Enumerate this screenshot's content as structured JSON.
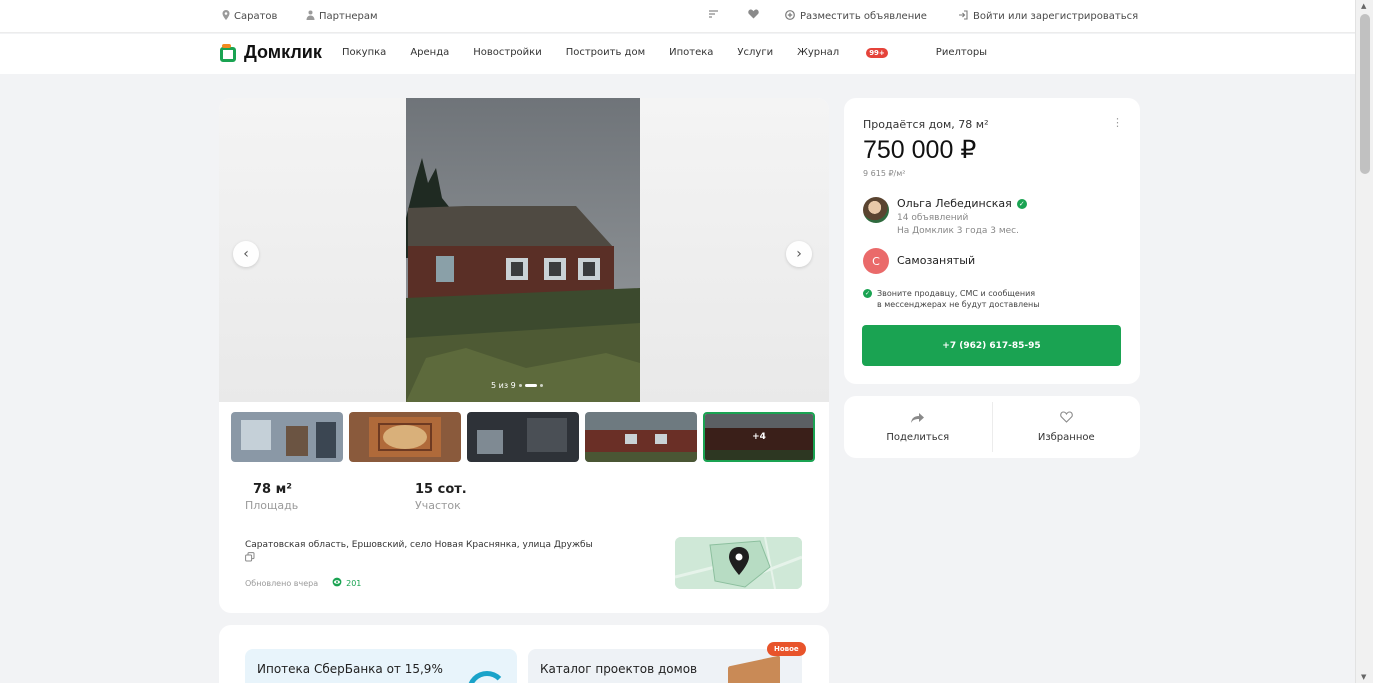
{
  "topbar": {
    "city": "Саратов",
    "partners": "Партнерам",
    "post_ad": "Разместить объявление",
    "login": "Войти или зарегистрироваться"
  },
  "navbar": {
    "logo": "Домклик",
    "items": [
      {
        "label": "Покупка"
      },
      {
        "label": "Аренда"
      },
      {
        "label": "Новостройки"
      },
      {
        "label": "Построить дом"
      },
      {
        "label": "Ипотека"
      },
      {
        "label": "Услуги"
      },
      {
        "label": "Журнал",
        "badge": "99+"
      },
      {
        "label": "Риелторы"
      }
    ]
  },
  "gallery": {
    "counter": "5 из 9",
    "more_photos": "+4",
    "specs": [
      {
        "value": "78 м²",
        "label": "Площадь"
      },
      {
        "value": "15 сот.",
        "label": "Участок"
      }
    ],
    "address": "Саратовская область, Ершовский, село Новая Краснянка, улица Дружбы",
    "updated": "Обновлено вчера",
    "views": "201"
  },
  "promo": {
    "mortgage": "Ипотека СберБанка от 15,9%",
    "catalog": "Каталог проектов домов",
    "new_badge": "Новое"
  },
  "sidebar": {
    "title": "Продаётся дом, 78 м²",
    "price": "750 000 ₽",
    "price_per_m2": "9 615 ₽/м²",
    "seller_name": "Ольга Лебединская",
    "seller_ads": "14 объявлений",
    "seller_since": "На Домклик 3 года 3 мес.",
    "status_initial": "С",
    "status": "Самозанятый",
    "note_line1": "Звоните продавцу, СМС и сообщения",
    "note_line2": "в мессенджерах не будут доставлены",
    "phone": "+7 (962) 617-85-95"
  },
  "actions": {
    "share": "Поделиться",
    "favorite": "Избранное"
  },
  "colors": {
    "accent": "#1aa352",
    "badge": "#e5433a",
    "new_badge": "#e8542b"
  }
}
